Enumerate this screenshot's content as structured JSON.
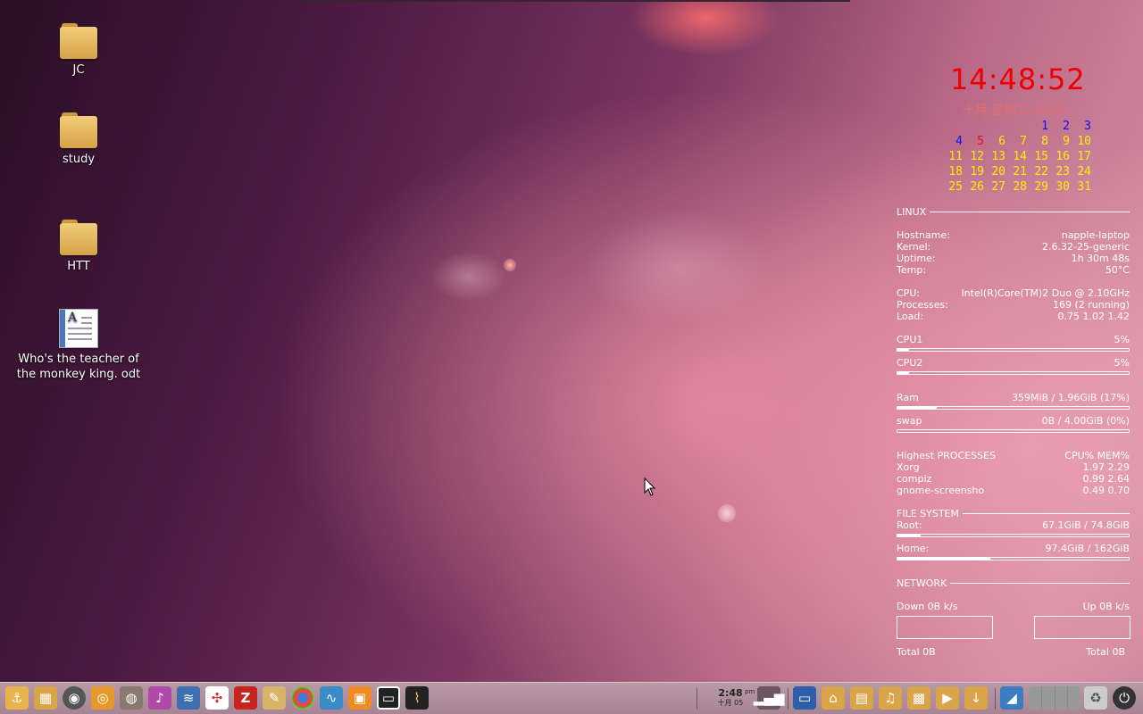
{
  "desktop": {
    "icons": [
      {
        "label": "JC",
        "type": "folder"
      },
      {
        "label": "study",
        "type": "folder"
      },
      {
        "label": "HTT",
        "type": "folder"
      },
      {
        "label": "Who's the teacher of the monkey king. odt",
        "type": "document"
      }
    ]
  },
  "conky": {
    "clock": "14:48:52",
    "calendar": {
      "title": "十月 星期二 2010",
      "rows": [
        [
          "",
          "",
          "",
          "",
          "1",
          "2",
          "3"
        ],
        [
          "4",
          "5",
          "6",
          "7",
          "8",
          "9",
          "10"
        ],
        [
          "11",
          "12",
          "13",
          "14",
          "15",
          "16",
          "17"
        ],
        [
          "18",
          "19",
          "20",
          "21",
          "22",
          "23",
          "24"
        ],
        [
          "25",
          "26",
          "27",
          "28",
          "29",
          "30",
          "31"
        ]
      ]
    },
    "linux": {
      "heading": "LINUX",
      "hostname_label": "Hostname:",
      "hostname": "napple-laptop",
      "kernel_label": "Kernel:",
      "kernel": "2.6.32-25-generic",
      "uptime_label": "Uptime:",
      "uptime": "1h 30m 48s",
      "temp_label": "Temp:",
      "temp": "50°C",
      "cpu_label": "CPU:",
      "cpu": "Intel(R)Core(TM)2 Duo @ 2.10GHz",
      "processes_label": "Processes:",
      "processes": "169 (2 running)",
      "load_label": "Load:",
      "load": "0.75 1.02 1.42"
    },
    "cpu1": {
      "label": "CPU1",
      "value": "5%",
      "fraction": 0.05
    },
    "cpu2": {
      "label": "CPU2",
      "value": "5%",
      "fraction": 0.05
    },
    "ram": {
      "label": "Ram",
      "value": "359MiB / 1.96GiB (17%)",
      "fraction": 0.17
    },
    "swap": {
      "label": "swap",
      "value": "0B  / 4.00GiB (0%)",
      "fraction": 0.0
    },
    "processes_table": {
      "heading": "Highest PROCESSES",
      "columns": "CPU% MEM%",
      "rows": [
        {
          "name": "Xorg",
          "values": "1.97  2.29"
        },
        {
          "name": "compiz",
          "values": "0.99  2.64"
        },
        {
          "name": "gnome-screensho",
          "values": "0.49  0.70"
        }
      ]
    },
    "filesystem": {
      "heading": "FILE SYSTEM",
      "root_label": "Root:",
      "root": "67.1GiB / 74.8GiB",
      "root_fraction": 0.1,
      "home_label": "Home:",
      "home": "97.4GiB / 162GiB",
      "home_fraction": 0.4
    },
    "network": {
      "heading": "NETWORK",
      "down": "Down 0B   k/s",
      "up": "Up 0B   k/s",
      "total_down": "Total 0B",
      "total_up": "Total 0B"
    }
  },
  "taskbar": {
    "clock_time": "2:48",
    "clock_ampm": "pm",
    "clock_date": "十月 05",
    "colors": {
      "bg": "#a78494"
    }
  }
}
